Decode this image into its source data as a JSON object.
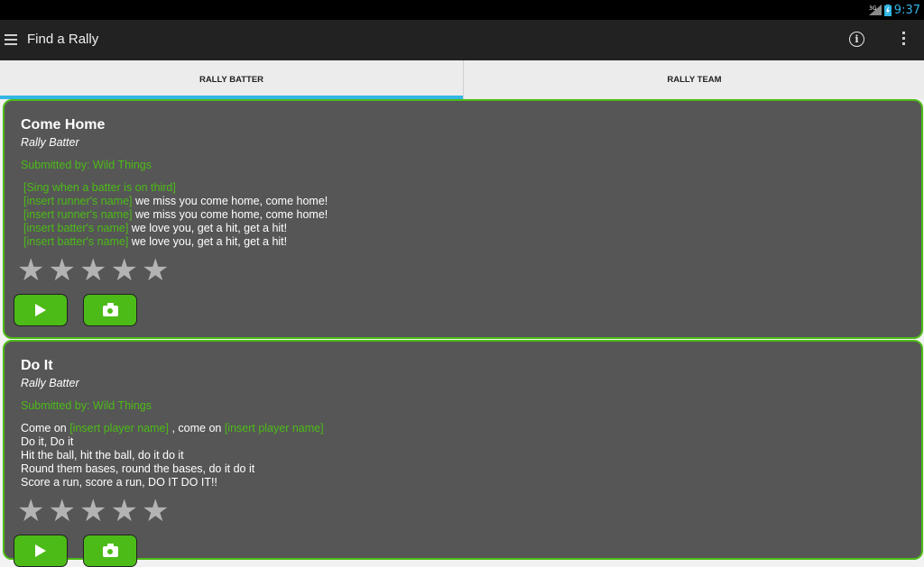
{
  "status": {
    "network": "3G",
    "time": "9:37"
  },
  "header": {
    "title": "Find a Rally",
    "info_icon": "info-icon",
    "overflow_icon": "overflow-icon"
  },
  "tabs": [
    {
      "label": "RALLY BATTER"
    },
    {
      "label": "RALLY TEAM"
    }
  ],
  "colors": {
    "accent": "#4cbb17",
    "tab_indicator": "#33b5e5",
    "card_bg": "#565656"
  },
  "cards": [
    {
      "title": "Come Home",
      "subtitle": "Rally Batter",
      "submitted": "Submitted by: Wild Things",
      "lines": [
        {
          "ph": "[Sing when a batter is on third]",
          "text": ""
        },
        {
          "ph": "[insert runner's name]",
          "text": " we miss you come home, come home!"
        },
        {
          "ph": "[insert runner's name]",
          "text": " we miss you come home, come home!"
        },
        {
          "ph": "[insert batter's name]",
          "text": " we love you, get a hit, get a hit!"
        },
        {
          "ph": "[insert batter's name]",
          "text": " we love you, get a hit, get a hit!"
        }
      ],
      "rating": 0
    },
    {
      "title": "Do It",
      "subtitle": "Rally Batter",
      "submitted": "Submitted by: Wild Things",
      "line1": {
        "a": "Come on ",
        "ph1": "[insert player name]",
        "b": " , come on ",
        "ph2": "[insert player name]"
      },
      "lines": [
        "Do it, Do it",
        "Hit the ball, hit the ball, do it do it",
        "Round them bases, round the bases, do it do it",
        "Score a run, score a run, DO IT DO IT!!"
      ],
      "rating": 0
    }
  ]
}
